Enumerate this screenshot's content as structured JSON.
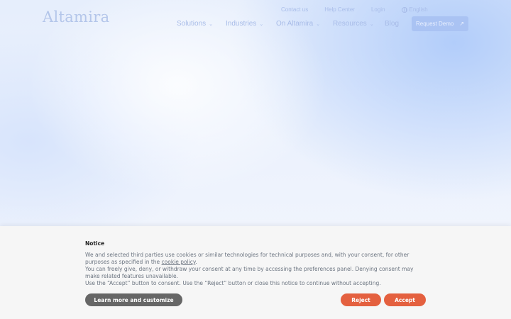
{
  "header": {
    "logo": "Altamira",
    "utility": {
      "contact": "Contact us",
      "help": "Help Center",
      "login": "Login",
      "language": "English"
    },
    "nav": {
      "solutions": "Solutions",
      "industries": "Industries",
      "on_altamira": "On Altamira",
      "resources": "Resources",
      "blog": "Blog"
    },
    "cta": "Request Demo",
    "cta_icon": "↗"
  },
  "cookie": {
    "title": "Notice",
    "line1_before": "We and selected third parties use cookies or similar technologies for technical purposes and, with your consent, for other purposes as specified in the ",
    "line1_link": "cookie policy",
    "line1_after": ".",
    "line2": "You can freely give, deny, or withdraw your consent at any time by accessing the preferences panel. Denying consent may make related features unavailable.",
    "line3": "Use the “Accept” button to consent. Use the “Reject” button or close this notice to continue without accepting.",
    "customize_label": "Learn more and customize",
    "reject_label": "Reject",
    "accept_label": "Accept"
  },
  "colors": {
    "accent": "#e4603f",
    "customize": "#666666",
    "nav_text": "#a8bce8"
  }
}
